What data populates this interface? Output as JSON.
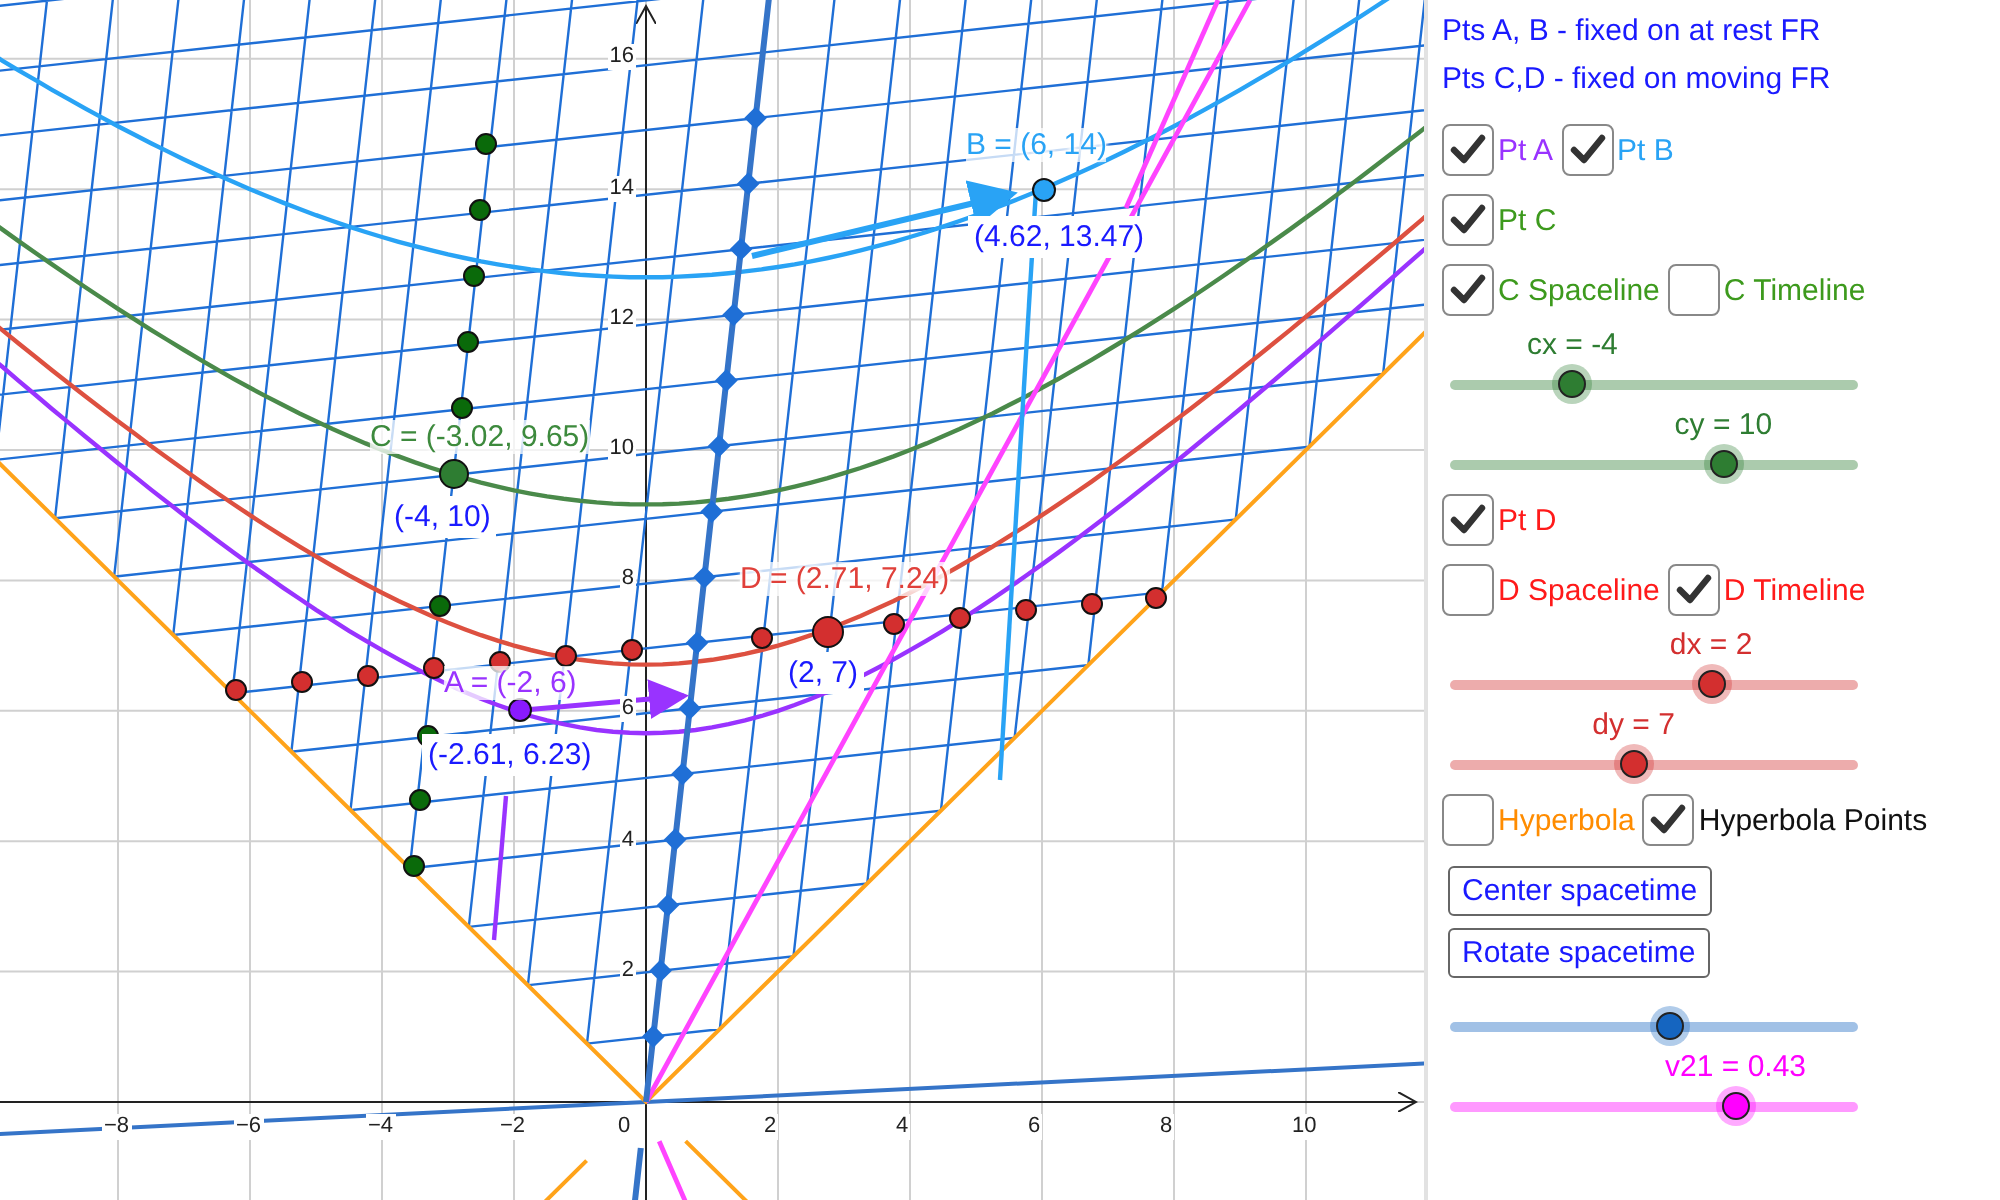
{
  "graph": {
    "x_ticks": [
      "−8",
      "−6",
      "−4",
      "−2",
      "0",
      "2",
      "4",
      "6",
      "8",
      "10"
    ],
    "y_ticks": [
      "16",
      "14",
      "12",
      "10",
      "8",
      "6",
      "4",
      "2"
    ],
    "point_labels": [
      {
        "text": "B = (6, 14)",
        "kind": "name",
        "color": "#29a3f5"
      },
      {
        "text": "(4.62, 13.47)",
        "kind": "coords",
        "color": "#1a1aff"
      },
      {
        "text": "C = (-3.02, 9.65)",
        "kind": "name",
        "color": "#3d8a3d"
      },
      {
        "text": "(-4, 10)",
        "kind": "coords",
        "color": "#1a1aff"
      },
      {
        "text": "D = (2.71, 7.24)",
        "kind": "name",
        "color": "#e0403a"
      },
      {
        "text": "(2, 7)",
        "kind": "coords",
        "color": "#1a1aff"
      },
      {
        "text": "A = (-2, 6)",
        "kind": "name",
        "color": "#9933ff"
      },
      {
        "text": "(-2.61, 6.23)",
        "kind": "coords",
        "color": "#1a1aff"
      }
    ]
  },
  "panel": {
    "items": [
      {
        "kind": "note",
        "text": "Pts A, B - fixed on at rest FR"
      },
      {
        "kind": "note",
        "text": "Pts C,D - fixed on moving FR"
      },
      {
        "kind": "checkboxes",
        "boxes": [
          {
            "label": "Pt A",
            "checked": true,
            "color": "#9933ff"
          },
          {
            "label": "Pt B",
            "checked": true,
            "color": "#29a3f5"
          }
        ]
      },
      {
        "kind": "checkboxes",
        "boxes": [
          {
            "label": "Pt C",
            "checked": true,
            "color": "#3d9a1d"
          }
        ]
      },
      {
        "kind": "checkboxes",
        "boxes": [
          {
            "label": "C Spaceline",
            "checked": true,
            "color": "#3d9a1d"
          },
          {
            "label": "C Timeline",
            "checked": false,
            "color": "#3d9a1d"
          }
        ]
      },
      {
        "kind": "slider",
        "label": "cx = -4",
        "level": 0.3,
        "color": "#2e7d32"
      },
      {
        "kind": "slider",
        "label": "cy = 10",
        "level": 0.67,
        "color": "#2e7d32"
      },
      {
        "kind": "checkboxes",
        "boxes": [
          {
            "label": "Pt D",
            "checked": true,
            "color": "#ff1a1a"
          }
        ]
      },
      {
        "kind": "checkboxes",
        "boxes": [
          {
            "label": "D Spaceline",
            "checked": false,
            "color": "#ff1a1a"
          },
          {
            "label": "D Timeline",
            "checked": true,
            "color": "#ff1a1a"
          }
        ]
      },
      {
        "kind": "slider",
        "label": "dx = 2",
        "level": 0.64,
        "color": "#d32f2f"
      },
      {
        "kind": "slider",
        "label": "dy = 7",
        "level": 0.45,
        "color": "#d32f2f"
      },
      {
        "kind": "checkboxes",
        "boxes": [
          {
            "label": "Hyperbola",
            "checked": false,
            "color": "#ff8c00"
          },
          {
            "label": "Hyperbola Points",
            "checked": true,
            "color": "#111111"
          }
        ]
      },
      {
        "kind": "button",
        "text": "Center spacetime"
      },
      {
        "kind": "button",
        "text": "Rotate spacetime"
      },
      {
        "kind": "slider",
        "level": 0.54,
        "color": "#1565c0"
      },
      {
        "kind": "slider",
        "label": "v21 = 0.43",
        "level": 0.7,
        "color": "#ff00ff"
      }
    ]
  }
}
